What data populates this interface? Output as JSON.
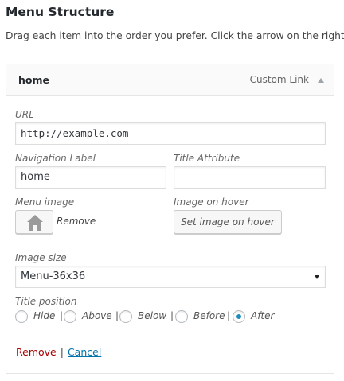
{
  "header": {
    "title": "Menu Structure",
    "instructions": "Drag each item into the order you prefer. Click the arrow on the right of"
  },
  "menu_item": {
    "title": "home",
    "type_label": "Custom Link",
    "fields": {
      "url": {
        "label": "URL",
        "value": "http://example.com"
      },
      "navigation_label": {
        "label": "Navigation Label",
        "value": "home"
      },
      "title_attribute": {
        "label": "Title Attribute",
        "value": ""
      },
      "menu_image": {
        "label": "Menu image",
        "remove_label": "Remove"
      },
      "image_on_hover": {
        "label": "Image on hover",
        "button_label": "Set image on hover"
      },
      "image_size": {
        "label": "Image size",
        "selected": "Menu-36x36"
      },
      "title_position": {
        "label": "Title position",
        "separator": "|",
        "options": [
          "Hide",
          "Above",
          "Below",
          "Before",
          "After"
        ],
        "selected": "After"
      }
    },
    "actions": {
      "remove": "Remove",
      "separator": "|",
      "cancel": "Cancel"
    }
  },
  "icons": {
    "thumbnail": "home-icon",
    "toggle": "triangle-up-icon",
    "select": "caret-down-icon"
  },
  "colors": {
    "link": "#0073aa",
    "remove": "#aa0000",
    "radio_checked": "#1e8cbe"
  }
}
